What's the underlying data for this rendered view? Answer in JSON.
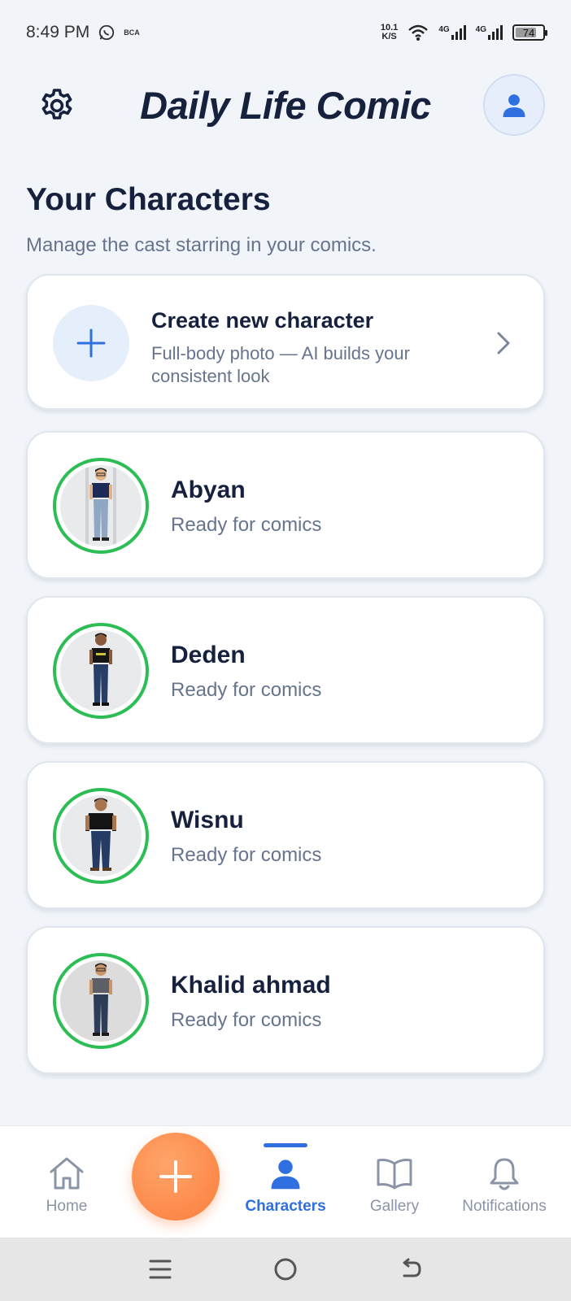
{
  "status_bar": {
    "time": "8:49 PM",
    "left_icons": [
      "whatsapp-icon",
      "bca-icon"
    ],
    "bca_label": "BCA",
    "net_speed_value": "10.1",
    "net_speed_unit": "K/S",
    "signal_1": "4G",
    "signal_2": "4G",
    "battery": "74"
  },
  "header": {
    "title": "Daily Life Comic",
    "settings_icon": "gear-icon",
    "profile_icon": "user-icon"
  },
  "section": {
    "title": "Your Characters",
    "subtitle": "Manage the cast starring in your comics."
  },
  "create_card": {
    "title": "Create new character",
    "description": "Full-body photo — AI builds your consistent look"
  },
  "characters": [
    {
      "name": "Abyan",
      "status": "Ready for comics"
    },
    {
      "name": "Deden",
      "status": "Ready for comics"
    },
    {
      "name": "Wisnu",
      "status": "Ready for comics"
    },
    {
      "name": "Khalid ahmad",
      "status": "Ready for comics"
    }
  ],
  "bottom_nav": {
    "items": [
      {
        "label": "Home",
        "icon": "home-icon"
      },
      {
        "label": "Characters",
        "icon": "user-icon",
        "active": true
      },
      {
        "label": "Gallery",
        "icon": "book-icon"
      },
      {
        "label": "Notifications",
        "icon": "bell-icon"
      }
    ],
    "fab_icon": "plus-icon"
  },
  "colors": {
    "accent": "#2f6fe0",
    "fab": "#fb7d3c",
    "ready": "#2dbd55",
    "text_dark": "#16213e",
    "text_muted": "#66748d"
  }
}
